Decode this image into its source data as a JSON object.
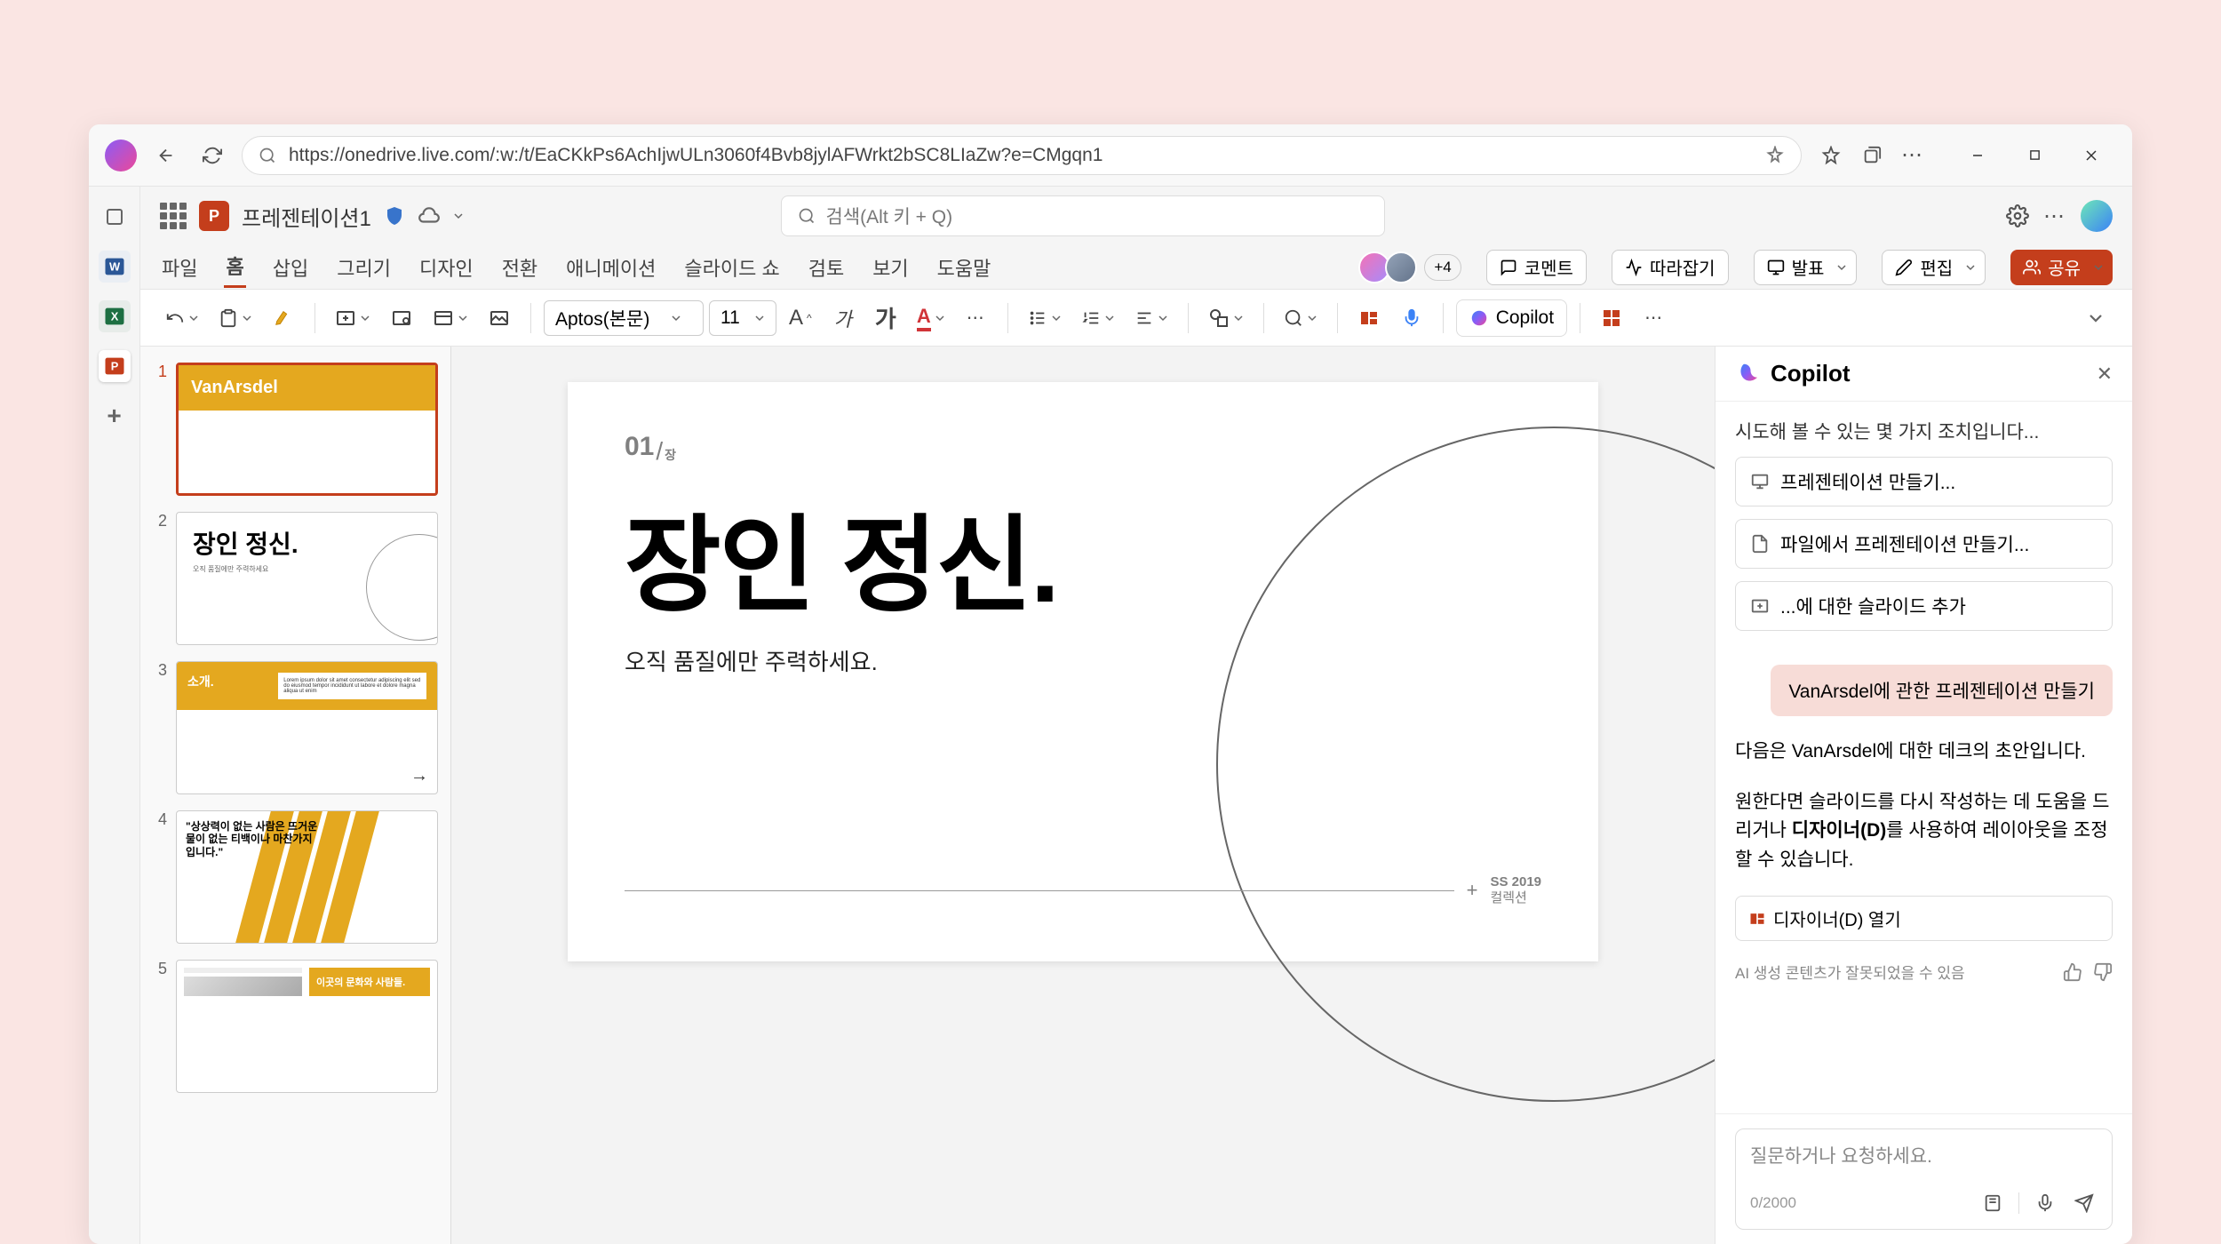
{
  "browser": {
    "url": "https://onedrive.live.com/:w:/t/EaCKkPs6AchIjwULn3060f4Bvb8jylAFWrkt2bSC8LIaZw?e=CMgqn1"
  },
  "titlebar": {
    "doc_title": "프레젠테이션1",
    "search_placeholder": "검색(Alt 키 + Q)"
  },
  "ribbon": {
    "tabs": [
      "파일",
      "홈",
      "삽입",
      "그리기",
      "디자인",
      "전환",
      "애니메이션",
      "슬라이드 쇼",
      "검토",
      "보기",
      "도움말"
    ],
    "active": 1,
    "presence_more": "+4",
    "comments": "코멘트",
    "catchup": "따라잡기",
    "present": "발표",
    "edit": "편집",
    "share": "공유"
  },
  "toolbar": {
    "font": "Aptos(본문)",
    "size": "11",
    "copilot": "Copilot"
  },
  "thumbs": {
    "t1_brand": "VanArsdel",
    "t2_title": "장인 정신.",
    "t2_sub": "오직 품질에만 주력하세요",
    "t3_title": "소개.",
    "t4_quote": "\"상상력이 없는 사람은 뜨거운 물이 없는 티백이나 마찬가지입니다.\"",
    "t5_text": "이곳의 문화와 사람들."
  },
  "slide": {
    "num": "01",
    "num_unit": "장",
    "title": "장인 정신.",
    "subtitle": "오직 품질에만 주력하세요.",
    "footer_year": "SS 2019",
    "footer_label": "컬렉션"
  },
  "copilot": {
    "title": "Copilot",
    "intro": "시도해 볼 수 있는 몇 가지 조치입니다...",
    "suggestions": [
      "프레젠테이션 만들기...",
      "파일에서 프레젠테이션 만들기...",
      "...에 대한 슬라이드 추가"
    ],
    "user_msg": "VanArsdel에 관한 프레젠테이션 만들기",
    "reply1": "다음은 VanArsdel에 대한 데크의 초안입니다.",
    "reply2a": "원한다면 슬라이드를 다시 작성하는 데 도움을 드리거나 ",
    "reply2b": "디자이너(D)",
    "reply2c": "를 사용하여 레이아웃을 조정할 수 있습니다.",
    "action": "디자이너(D) 열기",
    "disclaimer": "AI 생성 콘텐츠가 잘못되었을 수 있음",
    "placeholder": "질문하거나 요청하세요.",
    "counter": "0/2000"
  }
}
